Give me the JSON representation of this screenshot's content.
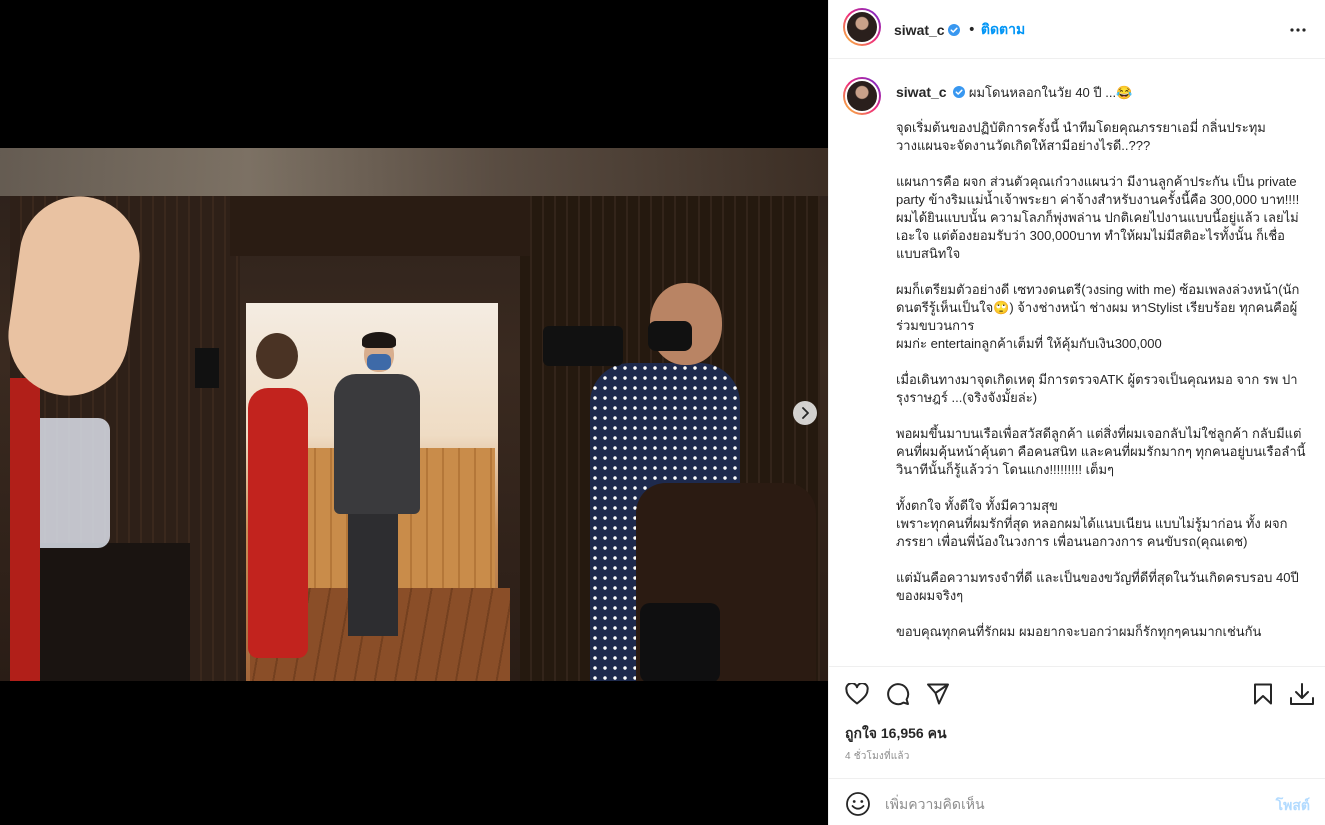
{
  "post": {
    "username": "siwat_c",
    "follow_label": "ติดตาม",
    "dot": "•",
    "caption_title": "ผมโดนหลอกในวัย 40 ปี ...😂",
    "caption_paragraphs": [
      "จุดเริ่มต้นของปฏิบัติการครั้งนี้ นำทีมโดยคุณภรรยาเอมี่ กลิ่นประทุม วางแผนจะจัดงานวัดเกิดให้สามีอย่างไรดี..???",
      "แผนการคือ ผจก ส่วนตัวคุณเก๋วางแผนว่า มีงานลูกค้าประกัน เป็น private party ข้างริมแม่น้ำเจ้าพระยา ค่าจ้างสำหรับงานครั้งนี้คือ 300,000 บาท!!!! ผมได้ยินแบบนั้น ความโลภก็พุ่งพล่าน ปกติเคยไปงานแบบนี้อยู่แล้ว เลยไม่เอะใจ แต่ต้องยอมรับว่า 300,000บาท ทำให้ผมไม่มีสติอะไรทั้งนั้น ก็เชื่อแบบสนิทใจ",
      "ผมก็เตรียมตัวอย่างดี เซทวงดนตรี(วงsing with me) ซ้อมเพลงล่วงหน้า(นักดนตรีรู้เห็นเป็นใจ🙄) จ้างช่างหน้า ช่างผม หาStylist เรียบร้อย ทุกคนคือผู้ร่วมขบวนการ\nผมก่ะ entertainลูกค้าเต็มที่ ให้คุ้มกับเงิน300,000",
      "เมื่อเดินทางมาจุดเกิดเหตุ มีการตรวจATK ผู้ตรวจเป็นคุณหมอ จาก รพ ปารุงราษฎร์ ...(จริงจังมั้ยล่ะ)",
      "พอผมขึ้นมาบนเรือเพื่อสวัสดีลูกค้า แต่สิ่งที่ผมเจอกลับไม่ใช่ลูกค้า กลับมีแต่คนที่ผมคุ้นหน้าคุ้นตา คือคนสนิท และคนที่ผมรักมากๆ ทุกคนอยู่บนเรือลำนี้\nวินาทีนั้นก็รู้แล้วว่า โดนแกง!!!!!!!!! เต็มๆ",
      "ทั้งตกใจ ทั้งดีใจ ทั้งมีความสุข\nเพราะทุกคนที่ผมรักที่สุด หลอกผมได้แนบเนียน แบบไม่รู้มาก่อน ทั้ง ผจก ภรรยา เพื่อนพี่น้องในวงการ เพื่อนนอกวงการ คนขับรถ(คุณเดช)",
      "แต่มันคือความทรงจำที่ดี และเป็นของขวัญที่ดีที่สุดในวันเกิดครบรอบ 40ปี ของผมจริงๆ",
      "ขอบคุณทุกคนที่รักผม ผมอยากจะบอกว่าผมก็รักทุกๆคนมากเช่นกัน"
    ],
    "likes_text": "ถูกใจ 16,956 คน",
    "time_ago": "4 ชั่วโมงที่แล้ว",
    "comment_placeholder": "เพิ่มความคิดเห็น",
    "post_button": "โพสต์"
  },
  "icons": {
    "more": "more-horizontal-icon",
    "like": "heart-icon",
    "comment": "comment-icon",
    "share": "send-icon",
    "save": "bookmark-icon",
    "download": "download-icon",
    "emoji": "emoji-icon",
    "next": "chevron-right-icon",
    "verified": "verified-badge-icon"
  },
  "colors": {
    "accent": "#0095f6",
    "verified": "#3897f0",
    "post_disabled": "#b3dbff",
    "muted": "#8e8e8e",
    "text": "#262626"
  }
}
